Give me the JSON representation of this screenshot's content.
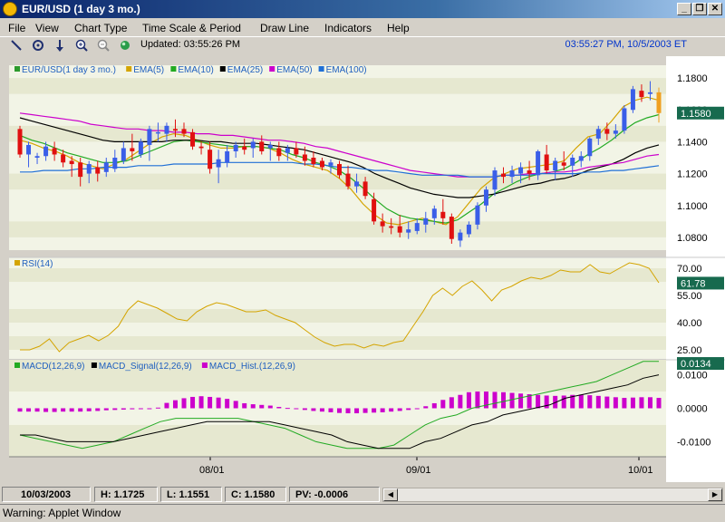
{
  "window": {
    "title": "EUR/USD (1 day  3 mo.)",
    "controls": [
      "_",
      "❐",
      "✕"
    ]
  },
  "menu": [
    "File",
    "View",
    "Chart Type",
    "Time Scale & Period",
    "Draw Line",
    "Indicators",
    "Help"
  ],
  "toolbar": {
    "updated": "Updated: 03:55:26 PM",
    "datetime": "03:55:27 PM, 10/5/2003 ET"
  },
  "chart_data": {
    "type": "candlestick",
    "x_labels": [
      "08/01",
      "09/01",
      "10/01"
    ],
    "price_panel": {
      "legend": [
        "EUR/USD(1 day  3 mo.)",
        "EMA(5)",
        "EMA(10)",
        "EMA(25)",
        "EMA(50)",
        "EMA(100)"
      ],
      "legend_colors": [
        "#2c9a2c",
        "#d4a400",
        "#22aa22",
        "#000000",
        "#cc00cc",
        "#1f6fd6"
      ],
      "y_ticks": [
        "1.1800",
        "1.1600",
        "1.1400",
        "1.1200",
        "1.1000",
        "1.0800"
      ],
      "ylim": [
        1.072,
        1.188
      ],
      "last_value": "1.1580",
      "ohlc": [
        [
          1.148,
          1.15,
          1.13,
          1.132
        ],
        [
          1.132,
          1.14,
          1.124,
          1.138
        ],
        [
          1.13,
          1.133,
          1.126,
          1.131
        ],
        [
          1.131,
          1.14,
          1.128,
          1.137
        ],
        [
          1.136,
          1.14,
          1.128,
          1.132
        ],
        [
          1.132,
          1.135,
          1.124,
          1.127
        ],
        [
          1.128,
          1.131,
          1.118,
          1.126
        ],
        [
          1.127,
          1.13,
          1.112,
          1.118
        ],
        [
          1.12,
          1.128,
          1.114,
          1.126
        ],
        [
          1.124,
          1.128,
          1.115,
          1.12
        ],
        [
          1.121,
          1.13,
          1.118,
          1.127
        ],
        [
          1.123,
          1.135,
          1.121,
          1.13
        ],
        [
          1.128,
          1.14,
          1.126,
          1.136
        ],
        [
          1.136,
          1.145,
          1.128,
          1.134
        ],
        [
          1.132,
          1.142,
          1.13,
          1.14
        ],
        [
          1.138,
          1.15,
          1.128,
          1.148
        ],
        [
          1.146,
          1.152,
          1.14,
          1.146
        ],
        [
          1.145,
          1.152,
          1.14,
          1.15
        ],
        [
          1.148,
          1.154,
          1.143,
          1.147
        ],
        [
          1.148,
          1.152,
          1.143,
          1.145
        ],
        [
          1.146,
          1.148,
          1.135,
          1.137
        ],
        [
          1.137,
          1.14,
          1.132,
          1.136
        ],
        [
          1.135,
          1.14,
          1.12,
          1.123
        ],
        [
          1.124,
          1.135,
          1.114,
          1.129
        ],
        [
          1.127,
          1.138,
          1.124,
          1.134
        ],
        [
          1.134,
          1.14,
          1.13,
          1.138
        ],
        [
          1.137,
          1.142,
          1.132,
          1.135
        ],
        [
          1.136,
          1.142,
          1.13,
          1.14
        ],
        [
          1.14,
          1.144,
          1.132,
          1.134
        ],
        [
          1.136,
          1.14,
          1.128,
          1.138
        ],
        [
          1.136,
          1.14,
          1.128,
          1.131
        ],
        [
          1.133,
          1.138,
          1.128,
          1.136
        ],
        [
          1.136,
          1.14,
          1.13,
          1.132
        ],
        [
          1.132,
          1.137,
          1.125,
          1.128
        ],
        [
          1.13,
          1.134,
          1.124,
          1.126
        ],
        [
          1.128,
          1.13,
          1.122,
          1.124
        ],
        [
          1.125,
          1.129,
          1.12,
          1.127
        ],
        [
          1.126,
          1.128,
          1.117,
          1.119
        ],
        [
          1.12,
          1.125,
          1.11,
          1.112
        ],
        [
          1.112,
          1.12,
          1.108,
          1.115
        ],
        [
          1.115,
          1.118,
          1.104,
          1.106
        ],
        [
          1.104,
          1.108,
          1.088,
          1.09
        ],
        [
          1.09,
          1.095,
          1.083,
          1.087
        ],
        [
          1.087,
          1.092,
          1.082,
          1.086
        ],
        [
          1.087,
          1.094,
          1.08,
          1.083
        ],
        [
          1.083,
          1.09,
          1.079,
          1.085
        ],
        [
          1.084,
          1.092,
          1.082,
          1.089
        ],
        [
          1.088,
          1.096,
          1.083,
          1.092
        ],
        [
          1.092,
          1.1,
          1.088,
          1.098
        ],
        [
          1.096,
          1.104,
          1.088,
          1.092
        ],
        [
          1.093,
          1.095,
          1.076,
          1.079
        ],
        [
          1.078,
          1.085,
          1.074,
          1.083
        ],
        [
          1.082,
          1.09,
          1.08,
          1.088
        ],
        [
          1.088,
          1.102,
          1.085,
          1.1
        ],
        [
          1.1,
          1.112,
          1.096,
          1.11
        ],
        [
          1.11,
          1.124,
          1.106,
          1.122
        ],
        [
          1.12,
          1.124,
          1.114,
          1.118
        ],
        [
          1.118,
          1.125,
          1.114,
          1.122
        ],
        [
          1.12,
          1.127,
          1.114,
          1.124
        ],
        [
          1.122,
          1.128,
          1.116,
          1.12
        ],
        [
          1.119,
          1.135,
          1.116,
          1.134
        ],
        [
          1.132,
          1.138,
          1.12,
          1.122
        ],
        [
          1.122,
          1.13,
          1.116,
          1.128
        ],
        [
          1.127,
          1.134,
          1.122,
          1.125
        ],
        [
          1.125,
          1.132,
          1.118,
          1.13
        ],
        [
          1.128,
          1.134,
          1.124,
          1.131
        ],
        [
          1.131,
          1.143,
          1.128,
          1.142
        ],
        [
          1.142,
          1.15,
          1.138,
          1.148
        ],
        [
          1.148,
          1.152,
          1.141,
          1.145
        ],
        [
          1.145,
          1.151,
          1.142,
          1.147
        ],
        [
          1.147,
          1.163,
          1.145,
          1.161
        ],
        [
          1.16,
          1.175,
          1.158,
          1.173
        ],
        [
          1.172,
          1.176,
          1.165,
          1.168
        ],
        [
          1.17,
          1.178,
          1.166,
          1.171
        ],
        [
          1.171,
          1.174,
          1.152,
          1.158
        ]
      ],
      "ema_series": {
        "EMA(5)": [
          1.141,
          1.139,
          1.136,
          1.134,
          1.131,
          1.127,
          1.125,
          1.123,
          1.126,
          1.129,
          1.134,
          1.139,
          1.143,
          1.145,
          1.144,
          1.141,
          1.138,
          1.136,
          1.136,
          1.137,
          1.137,
          1.136,
          1.133,
          1.129,
          1.126,
          1.124,
          1.122,
          1.117,
          1.11,
          1.101,
          1.094,
          1.089,
          1.088,
          1.09,
          1.092,
          1.09,
          1.088,
          1.093,
          1.102,
          1.111,
          1.117,
          1.12,
          1.123,
          1.124,
          1.125,
          1.126,
          1.128,
          1.136,
          1.143,
          1.145,
          1.153,
          1.162,
          1.166,
          1.168,
          1.166
        ],
        "EMA(10)": [
          1.144,
          1.141,
          1.139,
          1.136,
          1.133,
          1.131,
          1.129,
          1.127,
          1.127,
          1.128,
          1.131,
          1.134,
          1.137,
          1.14,
          1.141,
          1.14,
          1.139,
          1.138,
          1.137,
          1.137,
          1.137,
          1.136,
          1.135,
          1.132,
          1.13,
          1.127,
          1.125,
          1.122,
          1.117,
          1.111,
          1.104,
          1.098,
          1.094,
          1.092,
          1.091,
          1.09,
          1.089,
          1.091,
          1.096,
          1.101,
          1.107,
          1.111,
          1.115,
          1.118,
          1.12,
          1.121,
          1.123,
          1.127,
          1.132,
          1.136,
          1.141,
          1.147,
          1.152,
          1.155,
          1.157
        ],
        "EMA(25)": [
          1.155,
          1.153,
          1.151,
          1.149,
          1.147,
          1.145,
          1.143,
          1.141,
          1.14,
          1.14,
          1.14,
          1.14,
          1.14,
          1.141,
          1.141,
          1.141,
          1.14,
          1.14,
          1.139,
          1.139,
          1.139,
          1.138,
          1.137,
          1.136,
          1.135,
          1.133,
          1.131,
          1.129,
          1.127,
          1.124,
          1.12,
          1.117,
          1.114,
          1.111,
          1.109,
          1.107,
          1.106,
          1.105,
          1.105,
          1.106,
          1.107,
          1.109,
          1.111,
          1.113,
          1.114,
          1.116,
          1.117,
          1.119,
          1.122,
          1.124,
          1.126,
          1.129,
          1.133,
          1.136,
          1.138
        ],
        "EMA(50)": [
          1.158,
          1.157,
          1.156,
          1.155,
          1.154,
          1.153,
          1.151,
          1.15,
          1.149,
          1.148,
          1.148,
          1.147,
          1.147,
          1.146,
          1.146,
          1.145,
          1.145,
          1.144,
          1.144,
          1.143,
          1.142,
          1.141,
          1.141,
          1.14,
          1.139,
          1.137,
          1.136,
          1.134,
          1.132,
          1.13,
          1.128,
          1.126,
          1.124,
          1.122,
          1.121,
          1.12,
          1.119,
          1.118,
          1.118,
          1.118,
          1.118,
          1.119,
          1.119,
          1.12,
          1.12,
          1.121,
          1.121,
          1.122,
          1.124,
          1.125,
          1.126,
          1.127,
          1.129,
          1.131,
          1.132
        ],
        "EMA(100)": [
          1.121,
          1.121,
          1.122,
          1.122,
          1.122,
          1.123,
          1.123,
          1.124,
          1.124,
          1.124,
          1.125,
          1.125,
          1.125,
          1.126,
          1.126,
          1.126,
          1.126,
          1.127,
          1.127,
          1.127,
          1.127,
          1.127,
          1.127,
          1.127,
          1.126,
          1.126,
          1.125,
          1.124,
          1.124,
          1.123,
          1.122,
          1.122,
          1.121,
          1.12,
          1.119,
          1.119,
          1.119,
          1.119,
          1.118,
          1.118,
          1.118,
          1.119,
          1.119,
          1.119,
          1.12,
          1.12,
          1.12,
          1.12,
          1.121,
          1.121,
          1.122,
          1.122,
          1.123,
          1.124,
          1.125
        ]
      }
    },
    "rsi_panel": {
      "legend": "RSI(14)",
      "y_ticks": [
        "70.00",
        "55.00",
        "40.00",
        "25.00"
      ],
      "ylim": [
        20,
        76
      ],
      "last_value": "61.78",
      "values": [
        25,
        25,
        27,
        31,
        24,
        29,
        31,
        33,
        30,
        33,
        38,
        47,
        52,
        50,
        48,
        45,
        42,
        41,
        46,
        49,
        51,
        50,
        48,
        46,
        46,
        47,
        44,
        42,
        40,
        36,
        32,
        29,
        27,
        28,
        28,
        26,
        28,
        27,
        29,
        30,
        38,
        46,
        55,
        59,
        55,
        60,
        63,
        58,
        52,
        58,
        60,
        63,
        65,
        64,
        66,
        69,
        68,
        68,
        72,
        68,
        67,
        70,
        73,
        72,
        70,
        62
      ],
      "color": "#d4a400"
    },
    "macd_panel": {
      "legend": [
        "MACD(12,26,9)",
        "MACD_Signal(12,26,9)",
        "MACD_Hist.(12,26,9)"
      ],
      "legend_colors": [
        "#22aa22",
        "#000000",
        "#cc00cc"
      ],
      "y_ticks": [
        "0.0100",
        "0.0000",
        "-0.0100"
      ],
      "ylim": [
        -0.0145,
        0.0145
      ],
      "last_value": "0.0134",
      "macd": [
        -0.008,
        -0.009,
        -0.01,
        -0.011,
        -0.012,
        -0.011,
        -0.01,
        -0.008,
        -0.006,
        -0.004,
        -0.003,
        -0.003,
        -0.003,
        -0.003,
        -0.003,
        -0.004,
        -0.005,
        -0.006,
        -0.008,
        -0.01,
        -0.011,
        -0.012,
        -0.012,
        -0.012,
        -0.011,
        -0.008,
        -0.005,
        -0.003,
        -0.002,
        0.0,
        0.001,
        0.002,
        0.003,
        0.004,
        0.005,
        0.006,
        0.007,
        0.008,
        0.01,
        0.012,
        0.014,
        0.014
      ],
      "signal": [
        -0.008,
        -0.008,
        -0.009,
        -0.01,
        -0.01,
        -0.01,
        -0.01,
        -0.009,
        -0.008,
        -0.007,
        -0.006,
        -0.005,
        -0.004,
        -0.004,
        -0.004,
        -0.004,
        -0.004,
        -0.005,
        -0.006,
        -0.007,
        -0.008,
        -0.01,
        -0.011,
        -0.012,
        -0.012,
        -0.012,
        -0.01,
        -0.009,
        -0.007,
        -0.005,
        -0.004,
        -0.002,
        -0.001,
        0.0,
        0.001,
        0.003,
        0.004,
        0.005,
        0.006,
        0.007,
        0.009,
        0.01
      ],
      "hist": [
        -0.001,
        -0.001,
        -0.001,
        -0.0011,
        -0.0011,
        -0.001,
        -0.001,
        -0.001,
        -0.0009,
        -0.0008,
        -0.0006,
        -0.0005,
        -0.0004,
        -0.0003,
        -0.0002,
        0.0,
        0.0002,
        0.0016,
        0.0024,
        0.003,
        0.0034,
        0.0036,
        0.0034,
        0.0032,
        0.0028,
        0.0022,
        0.0015,
        0.0012,
        0.001,
        0.0008,
        0.0004,
        0.0001,
        -0.0002,
        -0.0005,
        -0.0008,
        -0.001,
        -0.0012,
        -0.0014,
        -0.0015,
        -0.0015,
        -0.0014,
        -0.0013,
        -0.0012,
        -0.001,
        -0.0008,
        -0.0005,
        -0.0002,
        0.0006,
        0.0015,
        0.0025,
        0.0033,
        0.004,
        0.0048,
        0.005,
        0.005,
        0.0049,
        0.0048,
        0.0046,
        0.0044,
        0.0042,
        0.004,
        0.0038,
        0.0037,
        0.0038,
        0.004,
        0.0041,
        0.0039,
        0.0037,
        0.0035,
        0.0033,
        0.0031,
        0.0032,
        0.0033,
        0.0033,
        0.0031
      ]
    }
  },
  "status": {
    "date": "10/03/2003",
    "high": "H: 1.1725",
    "low": "L: 1.1551",
    "close": "C: 1.1580",
    "pv": "PV: -0.0006"
  },
  "warning": "Warning: Applet Window"
}
